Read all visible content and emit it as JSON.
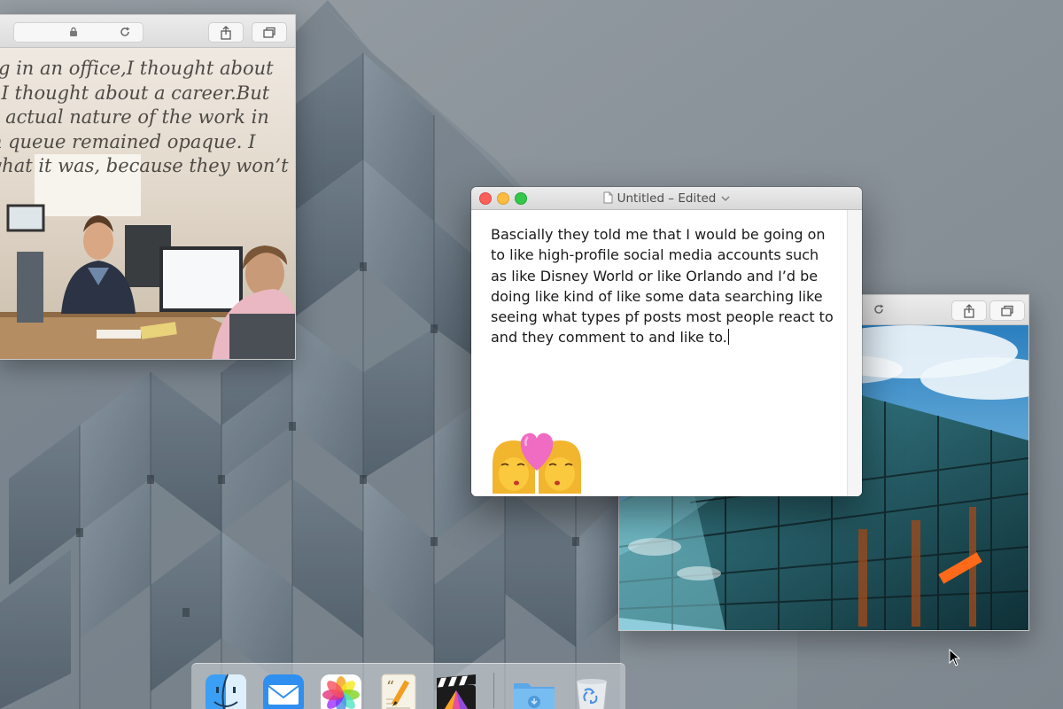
{
  "left_safari": {
    "article_lines": [
      "king in an office,I thought about",
      "es. I thought about a career.But",
      "the actual nature of the work in",
      "ism queue remained opaque.  I",
      "a what it was, because they won’t"
    ]
  },
  "textedit": {
    "title": "Untitled – Edited",
    "body": "Bascially they told me that I would be going on to like high-profile social media accounts such as like Disney World or like Orlando and I’d be doing like kind of like some data searching like seeing what types pf posts most people react to and they comment to and like to."
  },
  "dock": {
    "items": [
      "finder-icon",
      "mail-icon",
      "photos-icon",
      "pages-icon",
      "final-cut-pro-icon",
      "downloads-folder-icon",
      "trash-icon"
    ]
  },
  "colors": {
    "close": "#fc605b",
    "minimize": "#fdbc40",
    "maximize": "#34c84a"
  }
}
